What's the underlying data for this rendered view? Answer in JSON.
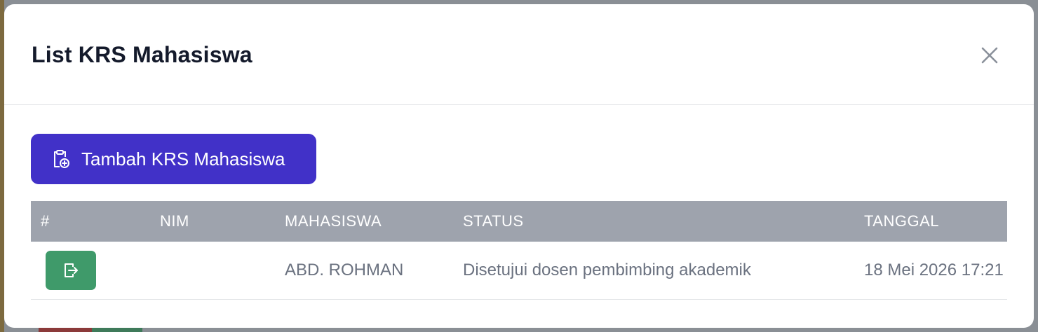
{
  "modal": {
    "title": "List KRS Mahasiswa",
    "close_icon": "close-icon"
  },
  "toolbar": {
    "add_label": "Tambah KRS Mahasiswa",
    "add_icon": "clipboard-plus-icon",
    "add_color": "#4131c8"
  },
  "table": {
    "headers": [
      "#",
      "NIM",
      "MAHASISWA",
      "STATUS",
      "TANGGAL"
    ],
    "header_color": "#9ea3ad",
    "rows": [
      {
        "action_icon": "export-icon",
        "action_color": "#3f9a6a",
        "nim": "",
        "mahasiswa": "ABD. ROHMAN",
        "status": "Disetujui dosen pembimbing akademik",
        "tanggal": "18 Mei 2026 17:21"
      }
    ]
  }
}
